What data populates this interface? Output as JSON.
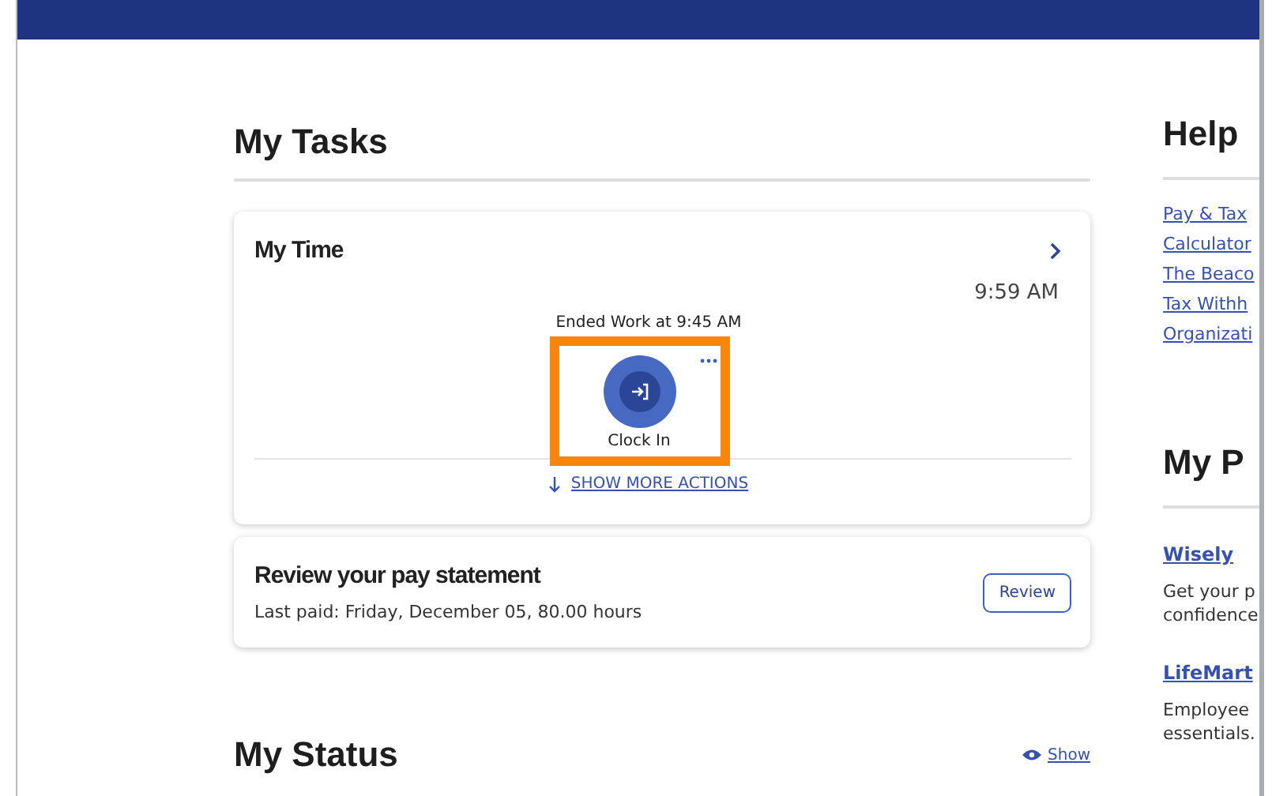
{
  "my_tasks": {
    "title": "My Tasks",
    "my_time": {
      "title": "My Time",
      "current_time": "9:59 AM",
      "last_event": "Ended Work at 9:45 AM",
      "action": "Clock In",
      "highlighted": true,
      "show_more": "SHOW MORE ACTIONS"
    },
    "pay_statement": {
      "title": "Review your pay statement",
      "last_paid": "Last paid: Friday, December 05, 80.00 hours",
      "button": "Review"
    }
  },
  "my_status": {
    "title": "My Status",
    "toggle": "Show"
  },
  "helpful": {
    "title": "Help",
    "links": [
      "Pay & Tax",
      "Calculator",
      "The Beaco",
      "Tax Withh",
      "Organizati"
    ]
  },
  "perks": {
    "title": "My P",
    "items": [
      {
        "name": "Wisely",
        "lines": [
          "Get your p",
          "confidence"
        ]
      },
      {
        "name": "LifeMart",
        "lines": [
          "Employee",
          "essentials."
        ]
      }
    ]
  }
}
